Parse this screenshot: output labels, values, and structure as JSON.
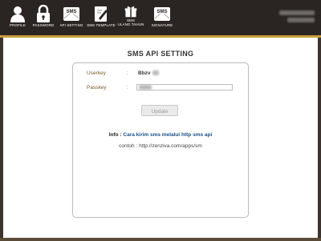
{
  "nav": {
    "items": [
      {
        "label": "PROFILE",
        "icon": "user-icon"
      },
      {
        "label": "PASSWORD",
        "icon": "lock-icon"
      },
      {
        "label": "API SETTING",
        "icon": "sms-envelope-icon"
      },
      {
        "label": "SMS TEMPLATE",
        "icon": "pencil-note-icon"
      },
      {
        "label": "SMS ULANG TAHUN",
        "icon": "gift-icon"
      },
      {
        "label": "SIGNATURE",
        "icon": "sms-envelope-icon"
      }
    ],
    "sms_badge": "SMS",
    "sms_ulang_line1": "SMS",
    "sms_ulang_line2": "ULANG TAHUN"
  },
  "colors": {
    "topbar": "#2a2522",
    "accent": "#c79a3c",
    "label": "#7a5a2a",
    "link": "#1a4f8a"
  },
  "page": {
    "title": "SMS API SETTING"
  },
  "form": {
    "userkey_label": "Userkey",
    "passkey_label": "Passkey",
    "colon": ":",
    "userkey_value": "Bbzv",
    "update_label": "Update"
  },
  "info": {
    "prefix": "Info :",
    "link_text": "Cara kirim sms melalui http sms api",
    "example": "contoh : http://zenziva.com/apps/sm"
  }
}
